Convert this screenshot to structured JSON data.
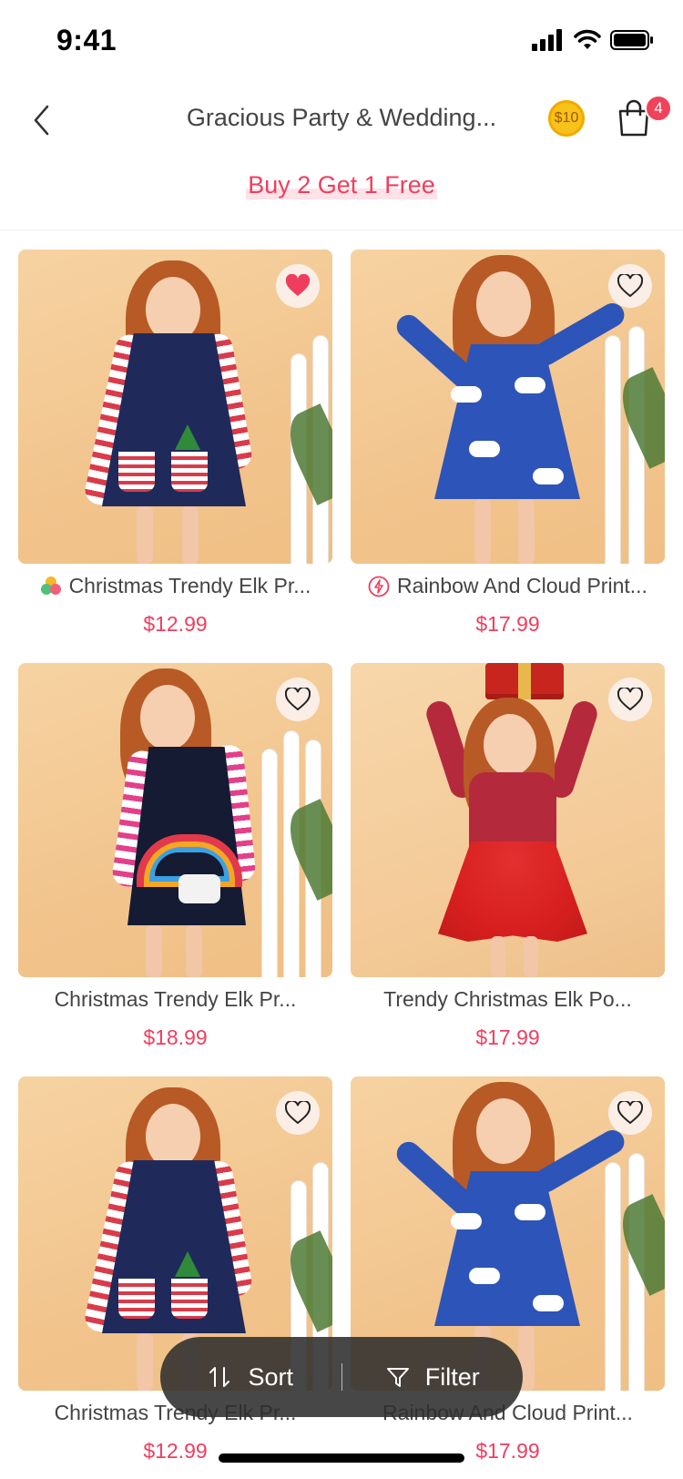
{
  "status_bar": {
    "time": "9:41"
  },
  "nav": {
    "title": "Gracious Party & Wedding...",
    "coin_label": "$10",
    "cart_count": "4"
  },
  "promo": {
    "text": "Buy 2 Get 1 Free"
  },
  "products": [
    {
      "name": "Christmas Trendy Elk Pr...",
      "price": "$12.99",
      "favorited": true,
      "tag_icon": "colors-icon",
      "style": "navy-stripe"
    },
    {
      "name": "Rainbow And Cloud Print...",
      "price": "$17.99",
      "favorited": false,
      "tag_icon": "flash-icon",
      "style": "blue-cloud"
    },
    {
      "name": "Christmas Trendy Elk Pr...",
      "price": "$18.99",
      "favorited": false,
      "tag_icon": "",
      "style": "navy-rainbow"
    },
    {
      "name": "Trendy Christmas Elk Po...",
      "price": "$17.99",
      "favorited": false,
      "tag_icon": "",
      "style": "red-tulle"
    },
    {
      "name": "Christmas Trendy Elk Pr...",
      "price": "$12.99",
      "favorited": false,
      "tag_icon": "",
      "style": "navy-stripe"
    },
    {
      "name": "Rainbow And Cloud Print...",
      "price": "$17.99",
      "favorited": false,
      "tag_icon": "",
      "style": "blue-cloud"
    }
  ],
  "toolbar": {
    "sort_label": "Sort",
    "filter_label": "Filter"
  },
  "colors": {
    "accent": "#ef3e5d",
    "badge": "#f0425a",
    "coin": "#f9c21b"
  }
}
